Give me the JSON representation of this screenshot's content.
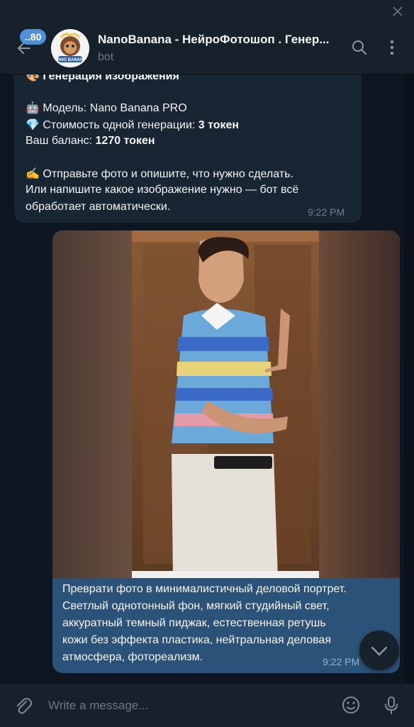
{
  "header": {
    "unread_count": "..80",
    "title": "NanoBanana - НейроФотошоп . Генер...",
    "subtitle": "bot",
    "avatar_text": "NANO BANANA"
  },
  "bot_message": {
    "cut_line": "Генерация изображения",
    "model_label": "Модель: Nano Banana PRO",
    "cost_prefix": "Стоимость одной генерации: ",
    "cost_value": "3 токен",
    "balance_prefix": "Ваш баланс: ",
    "balance_value": "1270 токен",
    "instruction_1": "Отправьте фото и опишите, что нужно сделать.",
    "instruction_2": "Или напишите какое изображение нужно — бот всё",
    "instruction_3": "обработает автоматически.",
    "time": "9:22 PM"
  },
  "user_message": {
    "caption_1": "Преврати фото в минималистичный деловой портрет.",
    "caption_2": "Светлый однотонный фон, мягкий студийный свет,",
    "caption_3": "аккуратный темный пиджак, естественная ретушь",
    "caption_4": "кожи без эффекта пластика, нейтральная деловая",
    "caption_5": "атмосфера, фотореализм.",
    "time": "9:22 PM"
  },
  "composer": {
    "placeholder": "Write a message..."
  },
  "icons": {
    "back": "arrow-left-icon",
    "search": "search-icon",
    "menu": "kebab-menu-icon",
    "attach": "paperclip-icon",
    "emoji": "emoji-icon",
    "mic": "microphone-icon",
    "scroll": "chevron-down-icon"
  }
}
